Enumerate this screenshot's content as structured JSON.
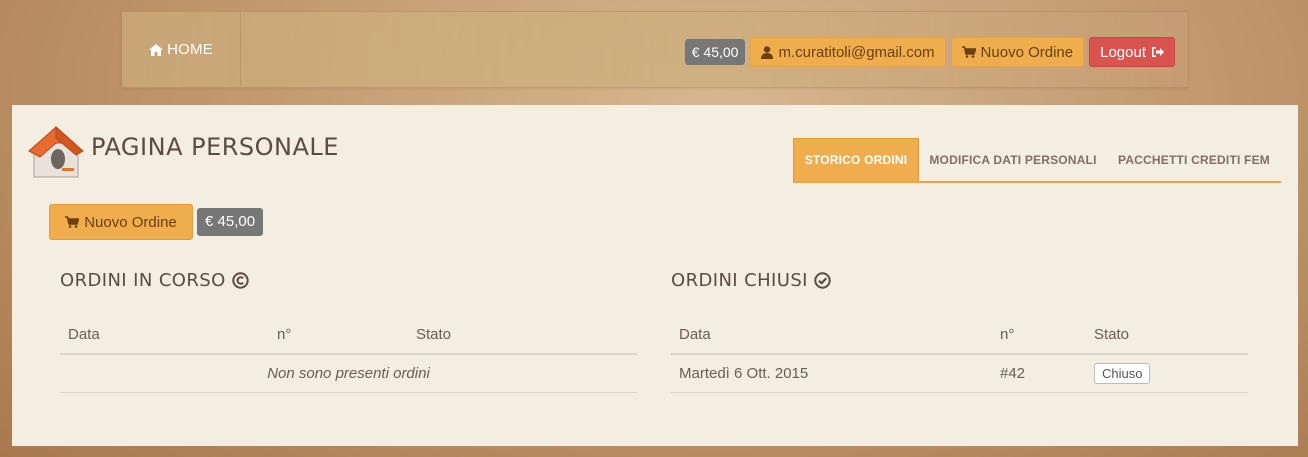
{
  "navbar": {
    "home_label": "HOME",
    "credit": "€ 45,00",
    "user_email": "m.curatitoli@gmail.com",
    "new_order_label": "Nuovo Ordine",
    "logout_label": "Logout"
  },
  "page": {
    "title": "PAGINA PERSONALE",
    "tabs": [
      {
        "label": "STORICO ORDINI",
        "active": true
      },
      {
        "label": "MODIFICA DATI PERSONALI",
        "active": false
      },
      {
        "label": "PACCHETTI CREDITI FEM",
        "active": false
      }
    ],
    "new_order_label": "Nuovo Ordine",
    "credit": "€ 45,00"
  },
  "open_orders": {
    "title": "ORDINI IN CORSO",
    "columns": [
      "Data",
      "n°",
      "Stato"
    ],
    "empty_text": "Non sono presenti ordini"
  },
  "closed_orders": {
    "title": "ORDINI CHIUSI",
    "columns": [
      "Data",
      "n°",
      "Stato"
    ],
    "rows": [
      {
        "date": "Martedì 6 Ott. 2015",
        "number": "#42",
        "status": "Chiuso"
      }
    ]
  },
  "colors": {
    "accent": "#f0ad4e",
    "danger": "#d9534f",
    "badge": "#777777",
    "panel": "#f4ede1"
  }
}
